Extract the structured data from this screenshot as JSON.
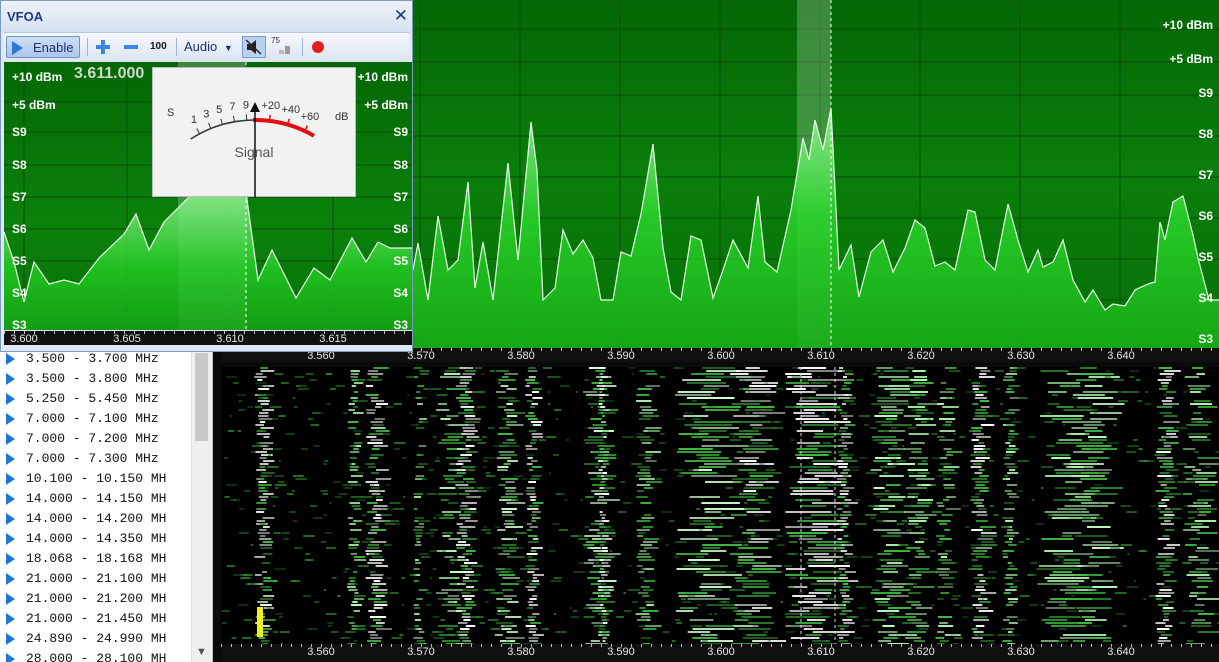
{
  "vfo": {
    "title": "VFOA",
    "close_glyph": "✕",
    "toolbar": {
      "enable_label": "Enable",
      "step_value": "100",
      "audio_label": "Audio",
      "squelch_value": "75"
    },
    "frequency_display": "3.611.000",
    "scale_left": [
      "+10 dBm",
      "+5 dBm",
      "S9",
      "S8",
      "S7",
      "S6",
      "S5",
      "S4",
      "S3"
    ],
    "scale_right": [
      "+10 dBm",
      "+5 dBm",
      "S9",
      "S8",
      "S7",
      "S6",
      "S5",
      "S4",
      "S3"
    ],
    "axis_ticks": [
      "3.600",
      "3.605",
      "3.610",
      "3.615"
    ],
    "smeter": {
      "s_label": "S",
      "s_ticks": [
        "1",
        "3",
        "5",
        "7",
        "9"
      ],
      "plus_ticks": [
        "+20",
        "+40",
        "+60"
      ],
      "db_label": "dB",
      "caption": "Signal"
    }
  },
  "spectrum": {
    "scale": [
      "+10 dBm",
      "+5 dBm",
      "S9",
      "S8",
      "S7",
      "S6",
      "S5",
      "S4",
      "S3"
    ],
    "axis_ticks": [
      "3.560",
      "3.570",
      "3.580",
      "3.590",
      "3.600",
      "3.610",
      "3.620",
      "3.630",
      "3.640"
    ]
  },
  "waterfall": {
    "axis_ticks": [
      "3.560",
      "3.570",
      "3.580",
      "3.590",
      "3.600",
      "3.610",
      "3.620",
      "3.630",
      "3.640"
    ]
  },
  "bands": [
    "3.500 - 3.700 MHz",
    "3.500 - 3.800 MHz",
    "5.250 - 5.450 MHz",
    "7.000 - 7.100 MHz",
    "7.000 - 7.200 MHz",
    "7.000 - 7.300 MHz",
    "10.100 - 10.150 MH",
    "14.000 - 14.150 MH",
    "14.000 - 14.200 MH",
    "14.000 - 14.350 MH",
    "18.068 - 18.168 MH",
    "21.000 - 21.100 MH",
    "21.000 - 21.200 MH",
    "21.000 - 21.450 MH",
    "24.890 - 24.990 MH",
    "28.000 - 28.100 MH"
  ],
  "colors": {
    "spectrum_fill": "#1fd21f",
    "grid": "#0c5a0c",
    "trace": "#d8ffd8",
    "waterfall_signal": "#3cb43c",
    "band_arrow": "#1e78d8"
  }
}
